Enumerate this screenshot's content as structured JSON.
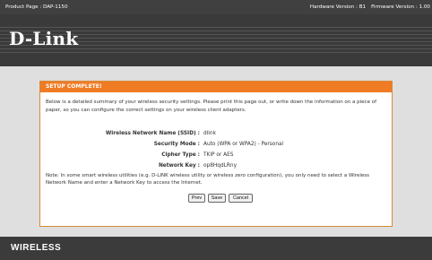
{
  "topbar": {
    "product_page": "Product Page : DAP-1150",
    "hardware_version": "Hardware Version : B1",
    "firmware_version": "Firmware Version : 1.00"
  },
  "brand": {
    "logo_text": "D-Link"
  },
  "panel": {
    "title": "SETUP COMPLETE!",
    "intro": "Below is a detailed summary of your wireless security settings. Please print this page out, or write down the information on a piece of paper, so you can configure the correct settings on your wireless client adapters.",
    "rows": [
      {
        "label": "Wireless Network Name (SSID) :",
        "value": "dlink"
      },
      {
        "label": "Security Mode :",
        "value": "Auto (WPA or WPA2) - Personal"
      },
      {
        "label": "Cipher Type :",
        "value": "TKIP or AES"
      },
      {
        "label": "Network Key :",
        "value": "op8HqdLRny"
      }
    ],
    "note": "Note: In some smart wireless utilities (e.g. D-LINK wireless utility or wireless zero configuration), you only need to select a Wireless Network Name and enter a Network Key to access the Internet.",
    "buttons": {
      "prev": "Prev",
      "save": "Save",
      "cancel": "Cancel"
    }
  },
  "footer": {
    "label": "WIRELESS"
  },
  "colors": {
    "accent_orange": "#f07b25",
    "header_dark": "#3a3a3a",
    "page_gray": "#dfdfdf"
  }
}
